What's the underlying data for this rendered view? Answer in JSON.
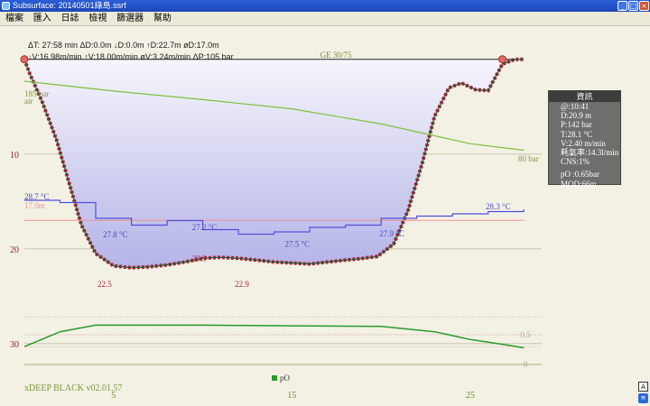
{
  "window": {
    "title": "Subsurface: 20140501綠島.ssrf",
    "buttons": [
      "_",
      "□",
      "×"
    ]
  },
  "menu": [
    "檔案",
    "匯入",
    "日誌",
    "檢視",
    "篩選器",
    "幫助"
  ],
  "stats": {
    "line1": "ΔT: 27:58 min ΔD:0.0m ↓D:0.0m ↑D:22.7m øD:17.0m",
    "line2": "↓V:16.98m/min ↑V:18.00m/min øV:3.24m/min ΔP:105 bar"
  },
  "info": {
    "title": "資訊",
    "lines": [
      "@:10:41",
      "D:20.9 m",
      "P:142 bar",
      "T:28.1 °C",
      "V:2.40 m/min",
      "耗氣率:14.3l/min",
      "CNS:1%"
    ],
    "lines2": [
      "pO :0.65bar",
      "MOD:66m"
    ]
  },
  "colors": {
    "depth_line": "#1e5a2e",
    "depth_fill": "#b4b4e8",
    "ceiling_marks": "#b2203c",
    "pressure": "#7fbf3c",
    "temperature": "#5050d8",
    "mean_depth": "#f09090",
    "po2": "#2a9a2a",
    "grid": "#c9c7b0",
    "axis_text": "#6a8a2a",
    "depth_axis": "#8a1a2a"
  },
  "chart_data": {
    "type": "line",
    "x_label_ticks": [
      5,
      15,
      25
    ],
    "x_range_min": [
      0,
      29
    ],
    "depth_ticks": [
      10,
      20,
      30
    ],
    "depth_range_m": [
      -3.5,
      36.5
    ],
    "gas_label": "GE 30/75",
    "gas_label_left": "air",
    "start_pressure": "185 bar",
    "end_pressure": "80 bar",
    "mean_depth_label": "17.0m",
    "start_temp_label": "28.7 °C",
    "end_temp_label": "28.3 °C",
    "series": [
      {
        "key": "depth",
        "x": [
          0,
          0.3,
          1,
          1.8,
          2.5,
          3.2,
          4,
          5,
          6,
          7,
          8,
          9,
          10,
          11,
          12,
          13,
          14,
          15,
          16,
          17,
          18,
          19,
          19.8,
          20.7,
          21.5,
          22.3,
          23,
          23.8,
          24.5,
          25.3,
          26,
          26.8,
          27.5,
          28
        ],
        "y": [
          0,
          1.5,
          4.5,
          8.5,
          13,
          17.5,
          20.5,
          21.8,
          22.0,
          21.9,
          21.7,
          21.4,
          21.0,
          20.9,
          21.0,
          21.2,
          21.4,
          21.5,
          21.6,
          21.4,
          21.2,
          21.0,
          20.8,
          19.5,
          16,
          11,
          6,
          3,
          2.5,
          3.2,
          3.3,
          0.5,
          0,
          0
        ]
      },
      {
        "key": "pressure_bar",
        "x": [
          0,
          5,
          10,
          15,
          20,
          25,
          28
        ],
        "y": [
          185,
          170,
          157,
          143,
          120,
          90,
          80
        ]
      },
      {
        "key": "temperature_c",
        "x": [
          0,
          2,
          4,
          6,
          8,
          10,
          12,
          14,
          16,
          18,
          20,
          22,
          24,
          26,
          28
        ],
        "y": [
          28.7,
          28.6,
          27.9,
          27.6,
          27.8,
          27.4,
          27.2,
          27.3,
          27.5,
          27.6,
          27.9,
          28.0,
          28.1,
          28.2,
          28.3
        ]
      },
      {
        "key": "po2",
        "x": [
          0,
          2,
          4,
          6,
          10,
          15,
          20,
          23,
          25,
          27,
          28
        ],
        "y": [
          0.3,
          0.55,
          0.66,
          0.66,
          0.66,
          0.65,
          0.64,
          0.55,
          0.42,
          0.33,
          0.28
        ]
      }
    ],
    "depth_labels": [
      {
        "x": 4.5,
        "y": 24.0,
        "t": "22.5"
      },
      {
        "x": 9.8,
        "y": 21.3,
        "t": "20.9"
      },
      {
        "x": 12.2,
        "y": 24.0,
        "t": "22.9"
      }
    ],
    "temp_labels": [
      {
        "x": 5.1,
        "y": 18.8,
        "t": "27.8 °C"
      },
      {
        "x": 10.1,
        "y": 18.0,
        "t": "27.2 °C"
      },
      {
        "x": 15.3,
        "y": 19.8,
        "t": "27.5 °C"
      },
      {
        "x": 20.6,
        "y": 18.7,
        "t": "27.9 °C"
      }
    ],
    "po2_ticks": [
      "0.5",
      "0"
    ],
    "legend": "pO",
    "model": "xDEEP BLACK v02.01.57"
  }
}
